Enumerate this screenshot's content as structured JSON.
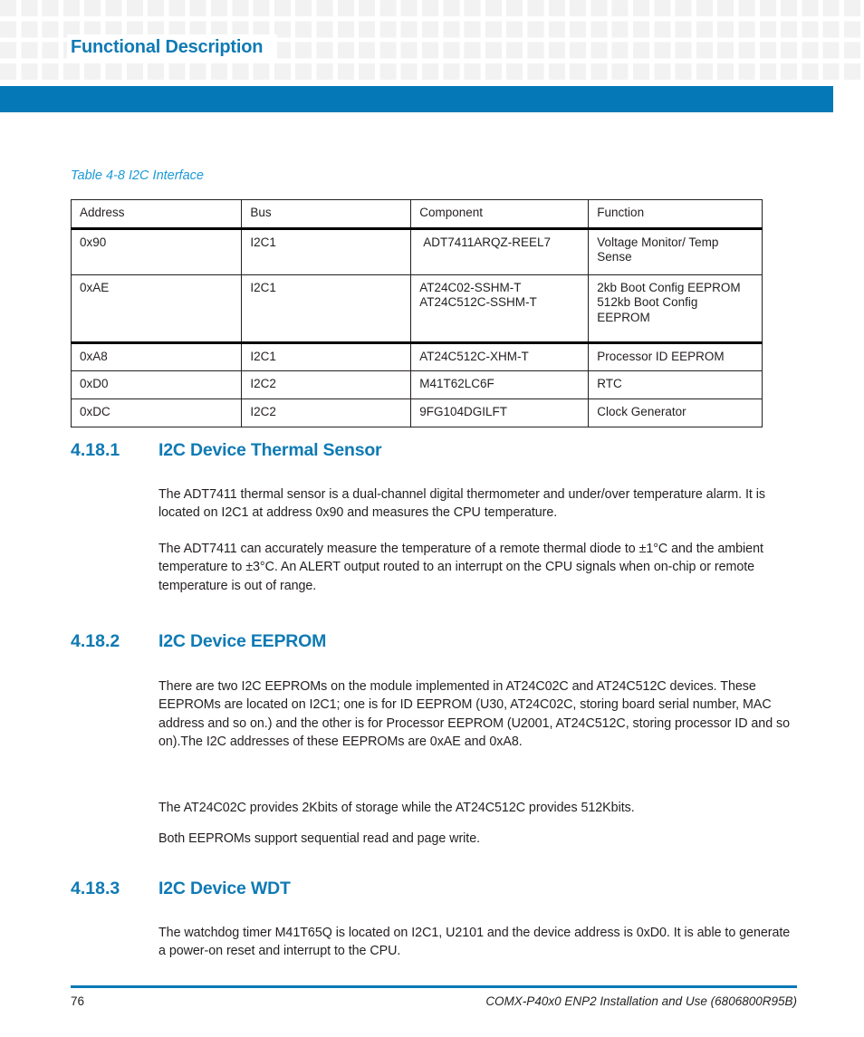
{
  "header": {
    "title": "Functional Description",
    "accent_color": "#0579b7",
    "heading_color": "#0f7ab4",
    "pattern_color": "#f2f2f2",
    "wedge_color": "#bcbec0"
  },
  "table": {
    "caption": "Table 4-8 I2C Interface",
    "caption_color": "#1b9ad6",
    "columns": [
      "Address",
      "Bus",
      "Component",
      "Function"
    ],
    "rows": [
      {
        "address": "0x90",
        "bus": "I2C1",
        "component": " ADT7411ARQZ-REEL7",
        "function": "Voltage Monitor/ Temp Sense"
      },
      {
        "address": "0xAE",
        "bus": "I2C1",
        "component": "AT24C02-SSHM-T AT24C512C-SSHM-T",
        "component_line1": "AT24C02-SSHM-T",
        "component_line2": "AT24C512C-SSHM-T",
        "function": " 2kb Boot Config EEPROM 512kb Boot Config EEPROM",
        "function_line1": " 2kb Boot Config EEPROM",
        "function_line2": "512kb Boot Config",
        "function_line3": "EEPROM"
      },
      {
        "address": "0xA8",
        "bus": "I2C1",
        "component": "AT24C512C-XHM-T",
        "function": " Processor ID EEPROM"
      },
      {
        "address": "0xD0",
        "bus": "I2C2",
        "component": "M41T62LC6F",
        "function": "RTC"
      },
      {
        "address": "0xDC",
        "bus": "I2C2",
        "component": "9FG104DGILFT",
        "function": "Clock Generator"
      }
    ]
  },
  "sections": [
    {
      "number": "4.18.1",
      "title": "I2C Device Thermal Sensor",
      "paragraphs": [
        "The ADT7411 thermal sensor is a dual-channel digital thermometer and under/over temperature alarm. It is located on I2C1 at address 0x90 and measures the CPU temperature.",
        "The ADT7411 can accurately measure the temperature of a remote thermal diode to ±1°C and the ambient temperature to ±3°C. An ALERT output routed to an interrupt on the CPU signals when on-chip or remote temperature is out of range."
      ]
    },
    {
      "number": "4.18.2",
      "title": "I2C Device EEPROM",
      "paragraphs": [
        "There are two I2C EEPROMs on the module implemented in AT24C02C and AT24C512C devices. These EEPROMs are located on I2C1; one is for ID EEPROM (U30, AT24C02C, storing board serial number, MAC address and so on.) and the other is for Processor EEPROM (U2001, AT24C512C, storing processor ID and so on).The I2C addresses of these EEPROMs are 0xAE and 0xA8.",
        "The AT24C02C provides 2Kbits of storage while the AT24C512C provides 512Kbits.",
        "Both EEPROMs support sequential read and page write."
      ]
    },
    {
      "number": "4.18.3",
      "title": "I2C Device WDT",
      "paragraphs": [
        "The watchdog timer M41T65Q is located on I2C1, U2101 and the device address is 0xD0. It is able to generate a power-on reset and interrupt to the CPU."
      ]
    }
  ],
  "footer": {
    "page_number": "76",
    "document_title": "COMX-P40x0 ENP2 Installation and Use (6806800R95B)"
  }
}
